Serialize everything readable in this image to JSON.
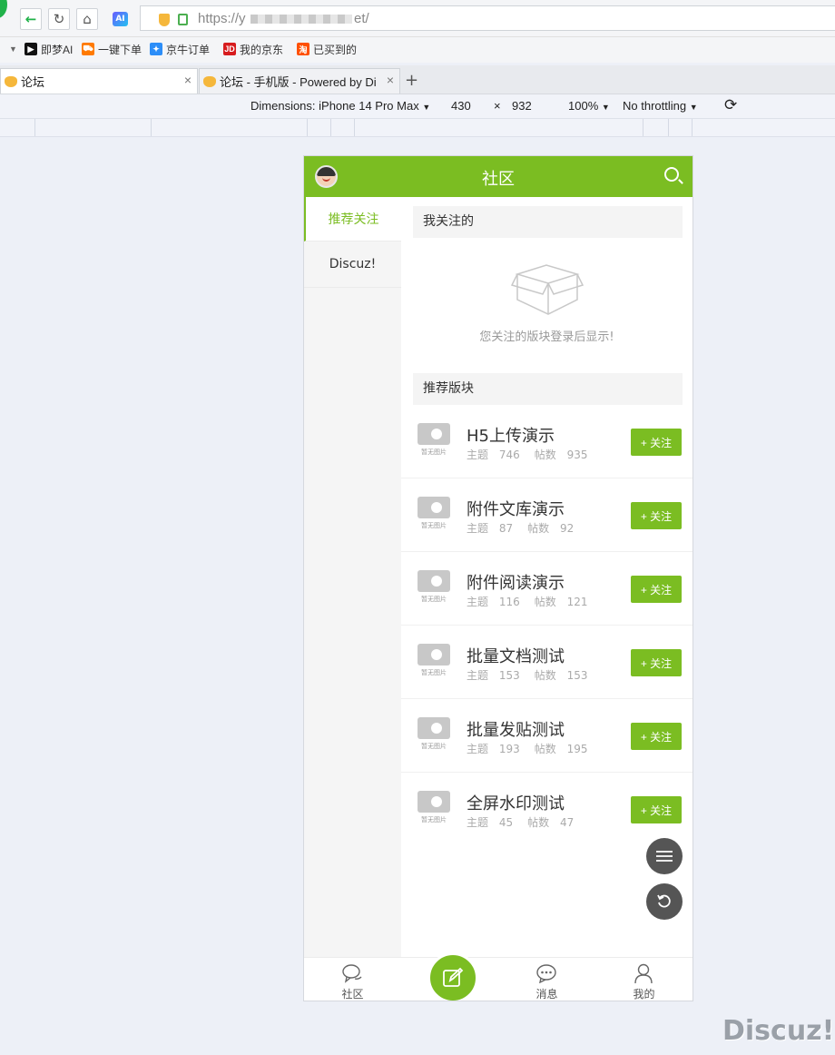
{
  "browser": {
    "url_prefix": "https://y",
    "url_suffix": "et/",
    "ai_badge": "AI",
    "bookmarks": [
      {
        "label": "即梦AI",
        "icon": "jimeng-icon",
        "color": "#111111"
      },
      {
        "label": "一键下单",
        "icon": "cart-icon",
        "color": "#ff7a00"
      },
      {
        "label": "京牛订单",
        "icon": "jingniu-icon",
        "color": "#2c8ef8"
      },
      {
        "label": "我的京东",
        "icon": "jd-icon",
        "color": "#d71c1e"
      },
      {
        "label": "已买到的",
        "icon": "taobao-icon",
        "color": "#ff5000"
      }
    ],
    "tabs": [
      {
        "label": "论坛"
      },
      {
        "label": "论坛 - 手机版 - Powered by Di"
      }
    ],
    "new_tab": "+",
    "close_glyph": "×"
  },
  "devtools": {
    "dimensions": "Dimensions: iPhone 14 Pro Max",
    "width": "430",
    "times": "×",
    "height": "932",
    "zoom": "100%",
    "throttling": "No throttling"
  },
  "app": {
    "title": "社区",
    "accent": "#7bbd22",
    "sidebar": [
      {
        "label": "推荐关注",
        "active": true
      },
      {
        "label": "Discuz!",
        "active": false
      }
    ],
    "followed_section": "我关注的",
    "empty_message": "您关注的版块登录后显示!",
    "recommended_section": "推荐版块",
    "no_image_caption": "暂无图片",
    "topics_label": "主题",
    "posts_label": "帖数",
    "follow_label": "+ 关注",
    "forums": [
      {
        "name": "H5上传演示",
        "topics": "746",
        "posts": "935"
      },
      {
        "name": "附件文库演示",
        "topics": "87",
        "posts": "92"
      },
      {
        "name": "附件阅读演示",
        "topics": "116",
        "posts": "121"
      },
      {
        "name": "批量文档测试",
        "topics": "153",
        "posts": "153"
      },
      {
        "name": "批量发贴测试",
        "topics": "193",
        "posts": "195"
      },
      {
        "name": "全屏水印测试",
        "topics": "45",
        "posts": "47"
      }
    ],
    "bottom_nav": [
      {
        "label": "社区",
        "icon": "chat-bubbles-icon"
      },
      {
        "label": "",
        "icon": "compose-icon"
      },
      {
        "label": "消息",
        "icon": "message-icon"
      },
      {
        "label": "我的",
        "icon": "user-icon"
      }
    ]
  },
  "watermark": "Discuz!"
}
